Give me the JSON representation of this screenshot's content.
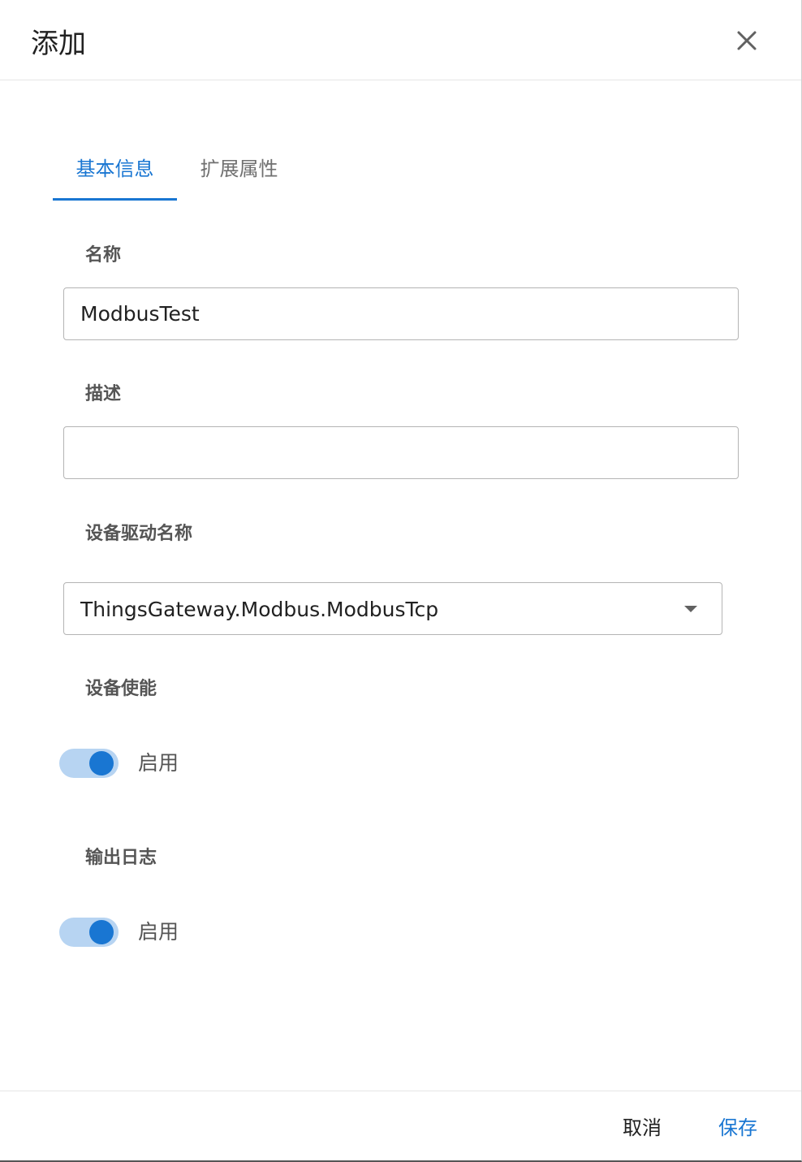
{
  "dialog": {
    "title": "添加",
    "close_icon": "close-icon"
  },
  "tabs": [
    {
      "label": "基本信息",
      "active": true
    },
    {
      "label": "扩展属性",
      "active": false
    }
  ],
  "form": {
    "name": {
      "label": "名称",
      "value": "ModbusTest"
    },
    "description": {
      "label": "描述",
      "value": ""
    },
    "driver": {
      "label": "设备驱动名称",
      "value": "ThingsGateway.Modbus.ModbusTcp"
    },
    "enable": {
      "label": "设备使能",
      "switch_text": "启用",
      "checked": true
    },
    "log_output": {
      "label": "输出日志",
      "switch_text": "启用",
      "checked": true
    }
  },
  "footer": {
    "cancel_label": "取消",
    "save_label": "保存"
  },
  "colors": {
    "accent": "#1976d2",
    "switch_track": "#b7d4f2"
  }
}
